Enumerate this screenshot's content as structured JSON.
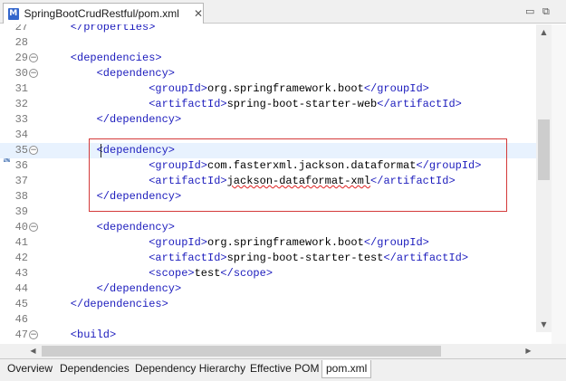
{
  "editor_tab": {
    "label": "SpringBootCrudRestful/pom.xml",
    "icon": "xml-file-icon",
    "close_glyph": "✕"
  },
  "window_controls": {
    "minimize": "▭",
    "maximize": "⧉"
  },
  "lines": [
    {
      "num": "27",
      "indent": 2,
      "parts": [
        {
          "t": "</properties>",
          "c": "tag"
        }
      ]
    },
    {
      "num": "28",
      "indent": 0,
      "parts": []
    },
    {
      "num": "29",
      "indent": 2,
      "fold": true,
      "parts": [
        {
          "t": "<dependencies>",
          "c": "tag"
        }
      ]
    },
    {
      "num": "30",
      "indent": 4,
      "fold": true,
      "parts": [
        {
          "t": "<dependency>",
          "c": "tag"
        }
      ]
    },
    {
      "num": "31",
      "indent": 8,
      "parts": [
        {
          "t": "<groupId>",
          "c": "tag"
        },
        {
          "t": "org.springframework.boot",
          "c": "txt"
        },
        {
          "t": "</groupId>",
          "c": "tag"
        }
      ]
    },
    {
      "num": "32",
      "indent": 8,
      "parts": [
        {
          "t": "<artifactId>",
          "c": "tag"
        },
        {
          "t": "spring-boot-starter-web",
          "c": "txt"
        },
        {
          "t": "</artifactId>",
          "c": "tag"
        }
      ]
    },
    {
      "num": "33",
      "indent": 4,
      "parts": [
        {
          "t": "</dependency>",
          "c": "tag"
        }
      ]
    },
    {
      "num": "34",
      "indent": 0,
      "parts": []
    },
    {
      "num": "35",
      "indent": 4,
      "fold": true,
      "current": true,
      "parts": [
        {
          "t": "<dependency>",
          "c": "tag"
        }
      ]
    },
    {
      "num": "36",
      "indent": 8,
      "parts": [
        {
          "t": "<groupId>",
          "c": "tag"
        },
        {
          "t": "com.fasterxml.jackson.dataformat",
          "c": "txt"
        },
        {
          "t": "</groupId>",
          "c": "tag"
        }
      ]
    },
    {
      "num": "37",
      "indent": 8,
      "parts": [
        {
          "t": "<artifactId>",
          "c": "tag"
        },
        {
          "t": "jackson-dataformat-xml",
          "c": "txt err"
        },
        {
          "t": "</artifactId>",
          "c": "tag"
        }
      ]
    },
    {
      "num": "38",
      "indent": 4,
      "parts": [
        {
          "t": "</dependency>",
          "c": "tag"
        }
      ]
    },
    {
      "num": "39",
      "indent": 0,
      "parts": []
    },
    {
      "num": "40",
      "indent": 4,
      "fold": true,
      "parts": [
        {
          "t": "<dependency>",
          "c": "tag"
        }
      ]
    },
    {
      "num": "41",
      "indent": 8,
      "parts": [
        {
          "t": "<groupId>",
          "c": "tag"
        },
        {
          "t": "org.springframework.boot",
          "c": "txt"
        },
        {
          "t": "</groupId>",
          "c": "tag"
        }
      ]
    },
    {
      "num": "42",
      "indent": 8,
      "parts": [
        {
          "t": "<artifactId>",
          "c": "tag"
        },
        {
          "t": "spring-boot-starter-test",
          "c": "txt"
        },
        {
          "t": "</artifactId>",
          "c": "tag"
        }
      ]
    },
    {
      "num": "43",
      "indent": 8,
      "parts": [
        {
          "t": "<scope>",
          "c": "tag"
        },
        {
          "t": "test",
          "c": "txt"
        },
        {
          "t": "</scope>",
          "c": "tag"
        }
      ]
    },
    {
      "num": "44",
      "indent": 4,
      "parts": [
        {
          "t": "</dependency>",
          "c": "tag"
        }
      ]
    },
    {
      "num": "45",
      "indent": 2,
      "parts": [
        {
          "t": "</dependencies>",
          "c": "tag"
        }
      ]
    },
    {
      "num": "46",
      "indent": 0,
      "parts": []
    },
    {
      "num": "47",
      "indent": 2,
      "fold": true,
      "parts": [
        {
          "t": "<build>",
          "c": "tag"
        }
      ]
    }
  ],
  "bottom_tabs": [
    {
      "label": "Overview",
      "active": false
    },
    {
      "label": "Dependencies",
      "active": false
    },
    {
      "label": "Dependency Hierarchy",
      "active": false
    },
    {
      "label": "Effective POM",
      "active": false
    },
    {
      "label": "pom.xml",
      "active": true
    }
  ],
  "colors": {
    "tag": "#1c1cbd",
    "text": "#000000",
    "line_number": "#787878",
    "current_line": "#e8f2fe",
    "highlight_box": "#d43a3a"
  }
}
